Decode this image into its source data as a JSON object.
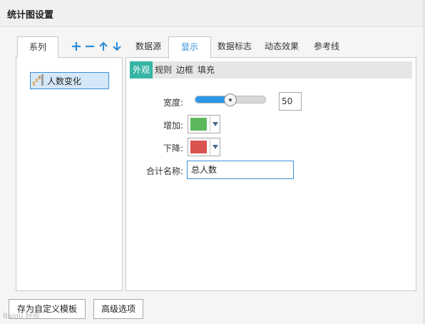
{
  "window": {
    "title": "统计图设置"
  },
  "series_tab": {
    "label": "系列"
  },
  "toolbar": {
    "icons": [
      "add-icon",
      "remove-icon",
      "move-up-icon",
      "move-down-icon"
    ],
    "accent": "#2a8ad4"
  },
  "series_list": {
    "items": [
      {
        "label": "人数变化",
        "icon": "waterfall-chart-icon"
      }
    ]
  },
  "tabs": [
    "数据源",
    "显示",
    "数据标志",
    "动态效果",
    "参考线"
  ],
  "active_tab": "显示",
  "subtabs": [
    "外观",
    "规则",
    "边框",
    "填充"
  ],
  "active_subtab": "外观",
  "display": {
    "width_label": "宽度:",
    "width_value": "50",
    "width_fraction": 0.5,
    "increase_label": "增加:",
    "increase_color": "#5cb85c",
    "decrease_label": "下降:",
    "decrease_color": "#d9534f",
    "total_name_label": "合计名称:",
    "total_name_value": "总人数"
  },
  "buttons": {
    "save_template": "存为自定义模板",
    "advanced": "高级选项"
  },
  "watermark": "Baidu 经验"
}
